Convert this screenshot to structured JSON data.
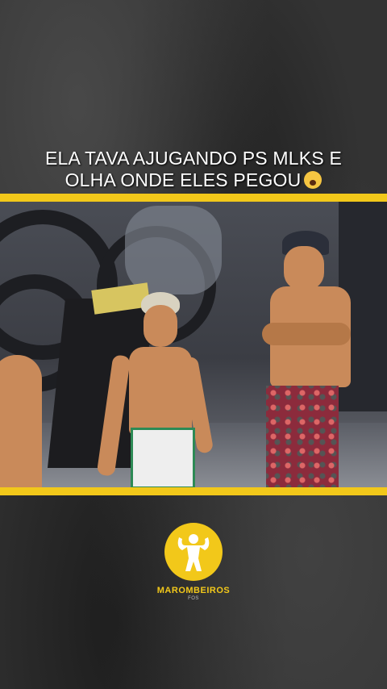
{
  "caption": {
    "line1": "ELA TAVA AJUGANDO PS MLKS E",
    "line2": "OLHA ONDE ELES PEGOU",
    "emoji": "screaming-face-emoji"
  },
  "colors": {
    "accent": "#f2c81a",
    "background": "#333333",
    "text": "#ffffff"
  },
  "logo": {
    "name": "MAROMBEIROS",
    "sub": "FOS",
    "icon": "bodybuilder-silhouette-icon"
  },
  "video": {
    "description_icon": "video-frame"
  }
}
